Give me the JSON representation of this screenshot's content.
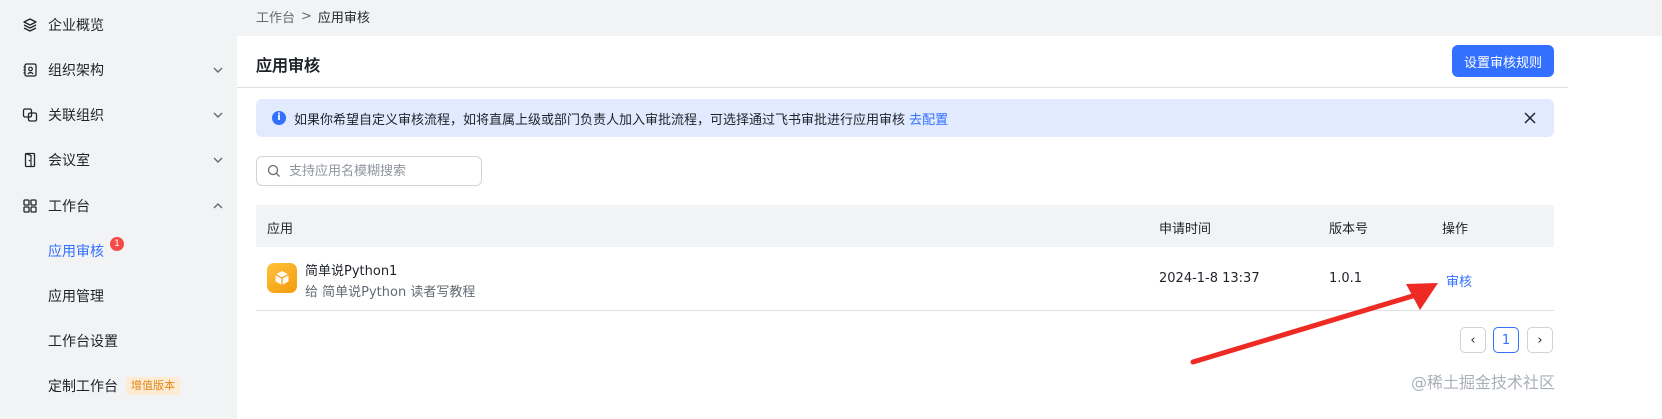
{
  "sidebar": {
    "items": [
      {
        "label": "企业概览",
        "icon": "layers-icon"
      },
      {
        "label": "组织架构",
        "icon": "contacts-book-icon"
      },
      {
        "label": "关联组织",
        "icon": "linked-org-icon"
      },
      {
        "label": "会议室",
        "icon": "door-icon"
      },
      {
        "label": "工作台",
        "icon": "grid-icon"
      }
    ],
    "sub_items": [
      {
        "label": "应用审核",
        "badge": "1"
      },
      {
        "label": "应用管理"
      },
      {
        "label": "工作台设置"
      },
      {
        "label": "定制工作台",
        "tag": "增值版本"
      }
    ]
  },
  "breadcrumb": {
    "root": "工作台",
    "sep": ">",
    "current": "应用审核"
  },
  "header": {
    "title": "应用审核",
    "rules_button": "设置审核规则"
  },
  "notice": {
    "text": "如果你希望自定义审核流程，如将直属上级或部门负责人加入审批流程，可选择通过飞书审批进行应用审核",
    "link": "去配置",
    "info_glyph": "i"
  },
  "search": {
    "placeholder": "支持应用名模糊搜索",
    "value": ""
  },
  "table": {
    "headers": {
      "app": "应用",
      "time": "申请时间",
      "version": "版本号",
      "action": "操作"
    },
    "rows": [
      {
        "name": "简单说Python1",
        "desc": "给 简单说Python 读者写教程",
        "time": "2024-1-8 13:37",
        "version": "1.0.1",
        "action": "审核"
      }
    ]
  },
  "pager": {
    "prev": "‹",
    "current": "1",
    "next": "›"
  },
  "watermark": "@稀土掘金技术社区",
  "colors": {
    "accent": "#3370ff",
    "annotation_arrow": "#ee2a24",
    "badge": "#f54a45"
  }
}
